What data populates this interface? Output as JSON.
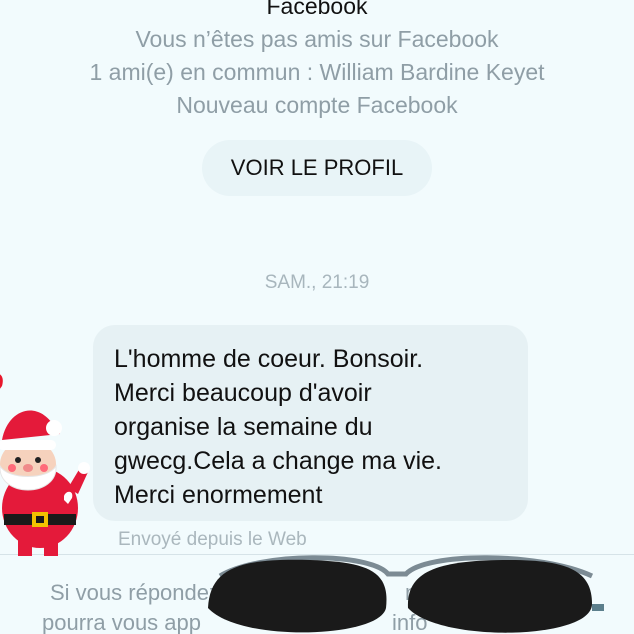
{
  "header": {
    "title": "Facebook",
    "not_friends": "Vous n’êtes pas amis sur Facebook",
    "mutual": "1 ami(e) en commun : William Bardine Keyet",
    "new_account": "Nouveau compte Facebook"
  },
  "profile_button": {
    "label": "VOIR LE PROFIL"
  },
  "timestamp": "SAM., 21:19",
  "message": {
    "lines": [
      "L'homme de coeur. Bonsoir.",
      "Merci beaucoup d'avoir",
      "organise la semaine du",
      "gwecg.Cela a change ma vie.",
      "Merci enormement"
    ],
    "sent_from": "Envoyé depuis le Web"
  },
  "footer": {
    "line1_left": "Si vous répondez",
    "line1_right": "nue",
    "line2_left": "pourra vous app",
    "line2_right": "info"
  },
  "stickers": {
    "santa": "santa-sticker",
    "sunglasses": "sunglasses-sticker"
  },
  "colors": {
    "background": "#f2fbfd",
    "bubble": "#e6f1f4",
    "muted_text": "#8f9ea6",
    "button": "#e8f4f7"
  }
}
